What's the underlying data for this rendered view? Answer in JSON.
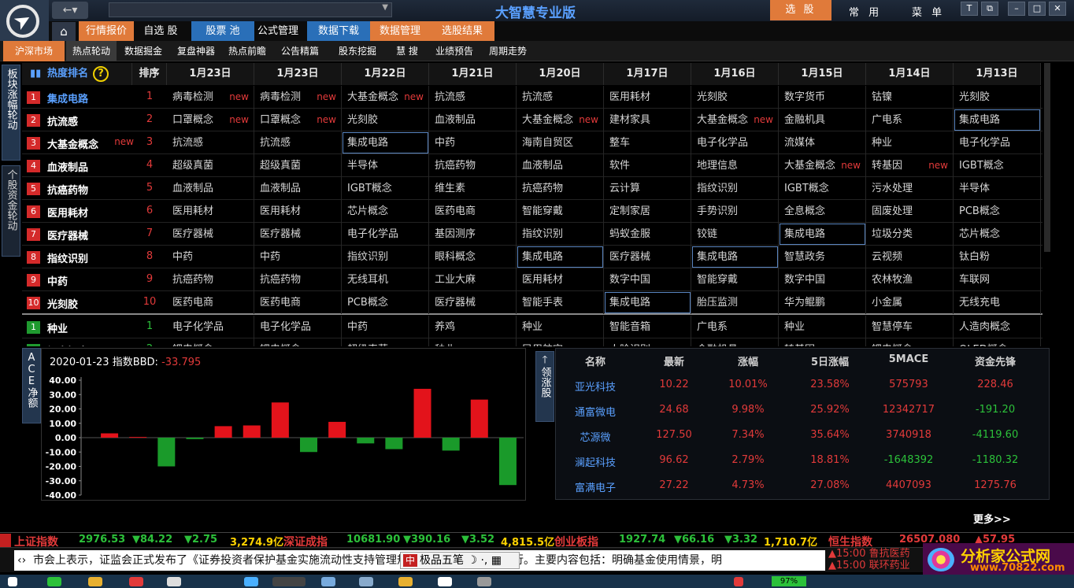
{
  "app": {
    "title": "大智慧专业版",
    "select_stock": "选 股",
    "menu_common": "常 用",
    "menu_menu": "菜 单"
  },
  "nav": {
    "back": "←▾",
    "home": "⌂"
  },
  "main_tabs": [
    {
      "label": "行情报价",
      "active": true
    },
    {
      "label": "自选 股",
      "active": false
    },
    {
      "label": "股票 池",
      "active": true
    },
    {
      "label": "公式管理",
      "active": false
    },
    {
      "label": "数据下载",
      "active": true
    },
    {
      "label": "数据管理",
      "active": true
    },
    {
      "label": "选股结果",
      "active": true
    }
  ],
  "sub_tabs": [
    {
      "label": "沪深市场",
      "active": true
    },
    {
      "label": "热点轮动",
      "active": false
    },
    {
      "label": "数据掘金",
      "active": false
    },
    {
      "label": "复盘神器",
      "active": false
    },
    {
      "label": "热点前瞻",
      "active": false
    },
    {
      "label": "公告精篇",
      "active": false
    },
    {
      "label": "股东挖掘",
      "active": false
    },
    {
      "label": "慧  搜",
      "active": false
    },
    {
      "label": "业绩预告",
      "active": false
    },
    {
      "label": "周期走势",
      "active": false
    }
  ],
  "side_labels": {
    "board": "板块涨幅轮动",
    "fund": "个股资金轮动",
    "ace": "ACE净额",
    "leader": "领涨股"
  },
  "heat_table": {
    "title": "热度排名",
    "help": "?",
    "rank_header": "排序",
    "dates": [
      "1月23日",
      "1月23日",
      "1月22日",
      "1月21日",
      "1月20日",
      "1月17日",
      "1月16日",
      "1月15日",
      "1月14日",
      "1月13日"
    ],
    "new_label": "new",
    "rows": [
      {
        "no": "1",
        "name": "集成电路",
        "name_new": false,
        "order": "1",
        "cells": [
          "病毒检测",
          "病毒检测",
          "大基金概念",
          "抗流感",
          "抗流感",
          "医用耗材",
          "光刻胶",
          "数字货币",
          "钴镍",
          "光刻胶"
        ],
        "news": [
          1,
          1,
          1,
          0,
          0,
          0,
          0,
          0,
          0,
          0
        ],
        "hl": [
          0,
          0,
          0,
          0,
          0,
          0,
          0,
          0,
          0,
          0
        ]
      },
      {
        "no": "2",
        "name": "抗流感",
        "name_new": false,
        "order": "2",
        "cells": [
          "口罩概念",
          "口罩概念",
          "光刻胶",
          "血液制品",
          "大基金概念",
          "建材家具",
          "大基金概念",
          "金融机具",
          "广电系",
          "集成电路"
        ],
        "news": [
          1,
          1,
          0,
          0,
          1,
          0,
          1,
          0,
          0,
          0
        ],
        "hl": [
          0,
          0,
          0,
          0,
          0,
          0,
          0,
          0,
          0,
          1
        ]
      },
      {
        "no": "3",
        "name": "大基金概念",
        "name_new": true,
        "order": "3",
        "cells": [
          "抗流感",
          "抗流感",
          "集成电路",
          "中药",
          "海南自贸区",
          "整车",
          "电子化学品",
          "流媒体",
          "种业",
          "电子化学品"
        ],
        "news": [
          0,
          0,
          0,
          0,
          0,
          0,
          0,
          0,
          0,
          0
        ],
        "hl": [
          0,
          0,
          1,
          0,
          0,
          0,
          0,
          0,
          0,
          0
        ]
      },
      {
        "no": "4",
        "name": "血液制品",
        "name_new": false,
        "order": "4",
        "cells": [
          "超级真菌",
          "超级真菌",
          "半导体",
          "抗癌药物",
          "血液制品",
          "软件",
          "地理信息",
          "大基金概念",
          "转基因",
          "IGBT概念"
        ],
        "news": [
          0,
          0,
          0,
          0,
          0,
          0,
          0,
          1,
          1,
          0
        ],
        "hl": [
          0,
          0,
          0,
          0,
          0,
          0,
          0,
          0,
          0,
          0
        ]
      },
      {
        "no": "5",
        "name": "抗癌药物",
        "name_new": false,
        "order": "5",
        "cells": [
          "血液制品",
          "血液制品",
          "IGBT概念",
          "维生素",
          "抗癌药物",
          "云计算",
          "指纹识别",
          "IGBT概念",
          "污水处理",
          "半导体"
        ],
        "news": [
          0,
          0,
          0,
          0,
          0,
          0,
          0,
          0,
          0,
          0
        ],
        "hl": [
          0,
          0,
          0,
          0,
          0,
          0,
          0,
          0,
          0,
          0
        ]
      },
      {
        "no": "6",
        "name": "医用耗材",
        "name_new": false,
        "order": "6",
        "cells": [
          "医用耗材",
          "医用耗材",
          "芯片概念",
          "医药电商",
          "智能穿戴",
          "定制家居",
          "手势识别",
          "全息概念",
          "固废处理",
          "PCB概念"
        ],
        "news": [
          0,
          0,
          0,
          0,
          0,
          0,
          0,
          0,
          0,
          0
        ],
        "hl": [
          0,
          0,
          0,
          0,
          0,
          0,
          0,
          0,
          0,
          0
        ]
      },
      {
        "no": "7",
        "name": "医疗器械",
        "name_new": false,
        "order": "7",
        "cells": [
          "医疗器械",
          "医疗器械",
          "电子化学品",
          "基因测序",
          "指纹识别",
          "蚂蚁金服",
          "铰链",
          "集成电路",
          "垃圾分类",
          "芯片概念"
        ],
        "news": [
          0,
          0,
          0,
          0,
          0,
          0,
          0,
          0,
          0,
          0
        ],
        "hl": [
          0,
          0,
          0,
          0,
          0,
          0,
          0,
          1,
          0,
          0
        ]
      },
      {
        "no": "8",
        "name": "指纹识别",
        "name_new": false,
        "order": "8",
        "cells": [
          "中药",
          "中药",
          "指纹识别",
          "眼科概念",
          "集成电路",
          "医疗器械",
          "集成电路",
          "智慧政务",
          "云视频",
          "钛白粉"
        ],
        "news": [
          0,
          0,
          0,
          0,
          0,
          0,
          0,
          0,
          0,
          0
        ],
        "hl": [
          0,
          0,
          0,
          0,
          1,
          0,
          1,
          0,
          0,
          0
        ]
      },
      {
        "no": "9",
        "name": "中药",
        "name_new": false,
        "order": "9",
        "cells": [
          "抗癌药物",
          "抗癌药物",
          "无线耳机",
          "工业大麻",
          "医用耗材",
          "数字中国",
          "智能穿戴",
          "数字中国",
          "农林牧渔",
          "车联网"
        ],
        "news": [
          0,
          0,
          0,
          0,
          0,
          0,
          0,
          0,
          0,
          0
        ],
        "hl": [
          0,
          0,
          0,
          0,
          0,
          0,
          0,
          0,
          0,
          0
        ]
      },
      {
        "no": "10",
        "name": "光刻胶",
        "name_new": false,
        "order": "10",
        "cells": [
          "医药电商",
          "医药电商",
          "PCB概念",
          "医疗器械",
          "智能手表",
          "集成电路",
          "胎压监测",
          "华为鲲鹏",
          "小金属",
          "无线充电"
        ],
        "news": [
          0,
          0,
          0,
          0,
          0,
          0,
          0,
          0,
          0,
          0
        ],
        "hl": [
          0,
          0,
          0,
          0,
          0,
          1,
          0,
          0,
          0,
          0
        ]
      },
      {
        "no": "1",
        "name": "种业",
        "name_new": false,
        "order": "1",
        "green": true,
        "cells": [
          "电子化学品",
          "电子化学品",
          "中药",
          "养鸡",
          "种业",
          "智能音箱",
          "广电系",
          "种业",
          "智慧停车",
          "人造肉概念"
        ],
        "news": [
          0,
          0,
          0,
          0,
          0,
          0,
          0,
          0,
          0,
          0
        ],
        "hl": [
          0,
          0,
          0,
          0,
          0,
          0,
          0,
          0,
          0,
          0
        ]
      },
      {
        "no": "2",
        "name": "锂电概念",
        "name_new": false,
        "order": "2",
        "green": true,
        "cells": [
          "锂电概念",
          "锂电概念",
          "超级真菌",
          "种业",
          "民用航空",
          "人脸识别",
          "金融机具",
          "转基因",
          "锂电概念",
          "OLED概念"
        ],
        "news": [
          0,
          0,
          0,
          0,
          0,
          0,
          0,
          1,
          0,
          0
        ],
        "hl": [
          0,
          0,
          0,
          0,
          0,
          0,
          0,
          0,
          0,
          0
        ]
      }
    ]
  },
  "bbd": {
    "date": "2020-01-23",
    "label": "指数BBD:",
    "value": "-33.795"
  },
  "chart_data": {
    "type": "bar",
    "title": "",
    "xlabel": "",
    "ylabel": "",
    "ylim": [
      -40,
      40
    ],
    "yticks": [
      "40.00",
      "30.00",
      "20.00",
      "10.00",
      "0.00",
      "-10.00",
      "-20.00",
      "-30.00",
      "-40.00"
    ],
    "values": [
      3,
      0.5,
      -20,
      -1,
      8,
      8.5,
      24.5,
      -10,
      11,
      -4,
      -8,
      34,
      -9,
      26.5,
      -33
    ]
  },
  "leaders": {
    "headers": [
      "名称",
      "最新",
      "涨幅",
      "5日涨幅",
      "5MACE",
      "资金先锋"
    ],
    "rows": [
      {
        "name": "亚光科技",
        "last": "10.22",
        "chg": "10.01%",
        "chg5": "23.58%",
        "mace": "575793",
        "flow": "228.46",
        "mace_up": true,
        "flow_up": true
      },
      {
        "name": "通富微电",
        "last": "24.68",
        "chg": "9.98%",
        "chg5": "25.92%",
        "mace": "12342717",
        "flow": "-191.20",
        "mace_up": true,
        "flow_up": false
      },
      {
        "name": "芯源微",
        "last": "127.50",
        "chg": "7.34%",
        "chg5": "35.64%",
        "mace": "3740918",
        "flow": "-4119.60",
        "mace_up": true,
        "flow_up": false
      },
      {
        "name": "澜起科技",
        "last": "96.62",
        "chg": "2.79%",
        "chg5": "18.81%",
        "mace": "-1648392",
        "flow": "-1180.32",
        "mace_up": false,
        "flow_up": false
      },
      {
        "name": "富满电子",
        "last": "27.22",
        "chg": "4.73%",
        "chg5": "27.08%",
        "mace": "4407093",
        "flow": "1275.76",
        "mace_up": true,
        "flow_up": true
      }
    ],
    "more": "更多>>"
  },
  "ticker": {
    "sh_name": "上证指数",
    "sh_val": "2976.53",
    "sh_chg": "▼84.22",
    "sh_pct": "▼2.75",
    "sh_amt": "3,274.9亿",
    "sz_name": "深证成指",
    "sz_val": "10681.90",
    "sz_chg": "▼390.16",
    "sz_pct": "▼3.52",
    "sz_amt": "4,815.5亿",
    "cy_name": "创业板指",
    "cy_val": "1927.74",
    "cy_chg": "▼66.16",
    "cy_pct": "▼3.32",
    "cy_amt": "1,710.7亿",
    "hs_name": "恒生指数",
    "hs_val": "26507.080",
    "hs_chg": "▲57.95"
  },
  "news": {
    "text": "市会上表示，证监会正式发布了《证券投资者保护基金实施流动性支持管理规定》，自发布之日起施行。主要内容包括：明确基金使用情景，明",
    "ime_zh": "中",
    "ime_label": "极品五笔",
    "alerts": [
      "▲15:00 鲁抗医药",
      "▲15:00 联环药业"
    ]
  },
  "brand": {
    "name": "分析家公式网",
    "url": "www.70822.com"
  },
  "taskbar": {
    "battery": "97%"
  }
}
